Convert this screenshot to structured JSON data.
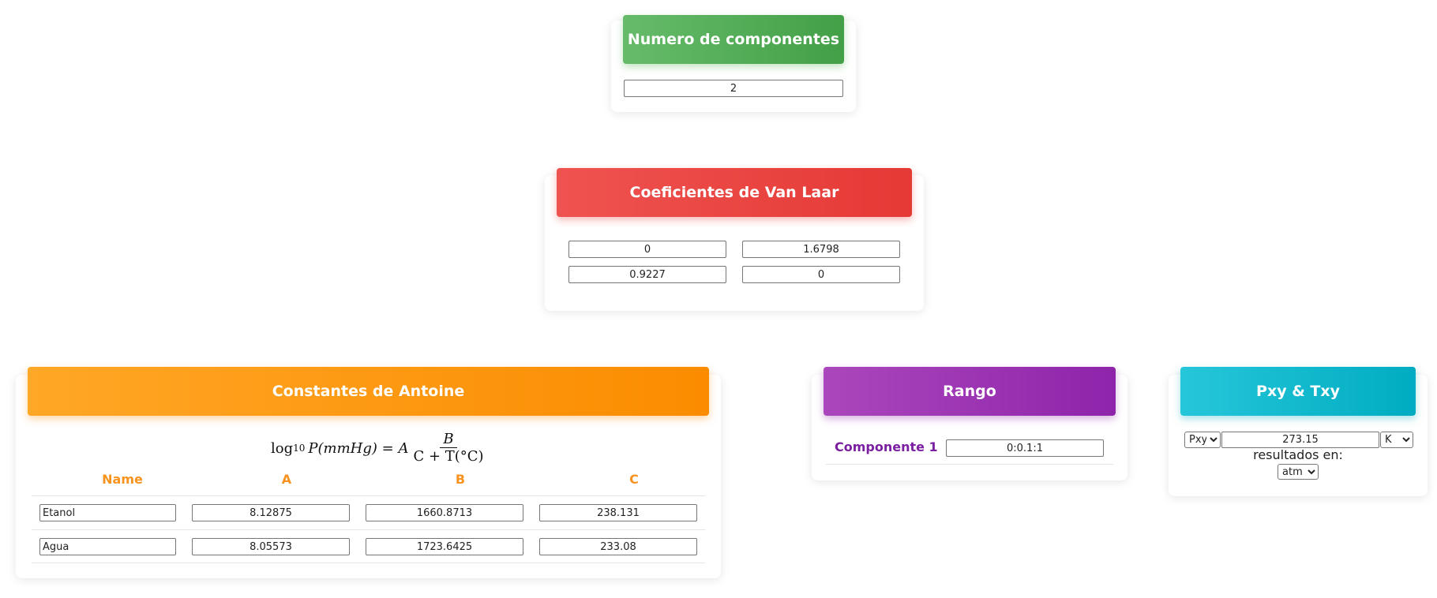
{
  "components_card": {
    "title": "Numero de componentes",
    "value": "2"
  },
  "vanlaar_card": {
    "title": "Coeficientes de Van Laar",
    "matrix": [
      [
        "0",
        "1.6798"
      ],
      [
        "0.9227",
        "0"
      ]
    ]
  },
  "antoine_card": {
    "title": "Constantes de Antoine",
    "formula": {
      "lhs": "log",
      "lhs_sub": "10",
      "lhs_arg": "P(mmHg) = A",
      "numerator": "B",
      "denominator": "C + T(°C)"
    },
    "columns": [
      "Name",
      "A",
      "B",
      "C"
    ],
    "rows": [
      {
        "name": "Etanol",
        "A": "8.12875",
        "B": "1660.8713",
        "C": "238.131"
      },
      {
        "name": "Agua",
        "A": "8.05573",
        "B": "1723.6425",
        "C": "233.08"
      }
    ]
  },
  "rango_card": {
    "title": "Rango",
    "label": "Componente 1",
    "value": "0:0.1:1"
  },
  "pxy_card": {
    "title": "Pxy & Txy",
    "mode_selected": "Pxy",
    "value": "273.15",
    "unit_selected": "K",
    "results_label": "resultados en:",
    "result_unit_selected": "atm"
  },
  "colors": {
    "green": "#4caf50",
    "red": "#e53935",
    "orange": "#fb8c00",
    "purple": "#8e24aa",
    "cyan": "#00acc1",
    "table_header": "#f7931e"
  }
}
